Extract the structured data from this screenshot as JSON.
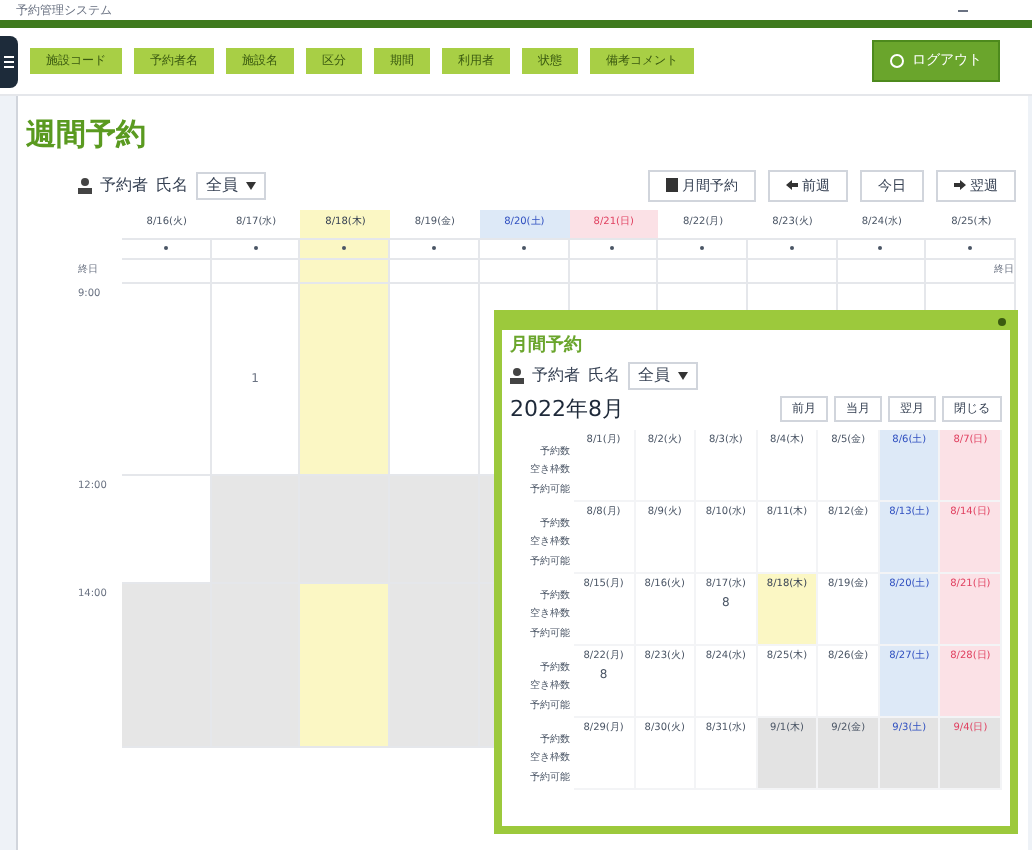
{
  "window": {
    "title": "予約管理システム"
  },
  "header": {
    "fields": [
      "施設コード",
      "予約者名",
      "施設名",
      "区分",
      "期間",
      "利用者",
      "状態",
      "備考コメント"
    ],
    "logout": "ログアウト"
  },
  "page_title": "週間予約",
  "filter": {
    "label": "予約者",
    "value": "氏名",
    "select": "全員"
  },
  "toolbar": [
    "月間予約",
    "前週",
    "今日",
    "翌週"
  ],
  "week": {
    "days": [
      {
        "label": "8/16(火)",
        "kind": "weekday"
      },
      {
        "label": "8/17(水)",
        "kind": "weekday"
      },
      {
        "label": "8/18(木)",
        "kind": "today"
      },
      {
        "label": "8/19(金)",
        "kind": "weekday"
      },
      {
        "label": "8/20(土)",
        "kind": "saturday"
      },
      {
        "label": "8/21(日)",
        "kind": "sunday"
      },
      {
        "label": "8/22(月)",
        "kind": "weekday"
      },
      {
        "label": "8/23(火)",
        "kind": "weekday"
      },
      {
        "label": "8/24(水)",
        "kind": "weekday"
      },
      {
        "label": "8/25(木)",
        "kind": "weekday"
      }
    ],
    "allday_left": "終日",
    "allday_right": "終日",
    "slots": [
      {
        "time": "9:00",
        "cells": [
          {
            "closed": false
          },
          {
            "text": "1",
            "closed": false
          },
          {
            "closed": false
          },
          {
            "closed": false
          },
          {
            "closed": false
          },
          {
            "closed": false
          },
          {
            "closed": false
          },
          {
            "closed": false
          },
          {
            "closed": false
          },
          {
            "closed": false
          }
        ]
      },
      {
        "time": "12:00",
        "cells": [
          {
            "closed": false
          },
          {
            "closed": true
          },
          {
            "closed": true
          },
          {
            "closed": true
          },
          {
            "closed": true
          }
        ]
      },
      {
        "time": "14:00",
        "cells": [
          {
            "closed": true
          },
          {
            "closed": true
          },
          {
            "closed": false
          },
          {
            "closed": true
          },
          {
            "closed": true
          }
        ]
      }
    ]
  },
  "month": {
    "title": "月間予約",
    "filter": {
      "label": "予約者",
      "value": "氏名",
      "select": "全員"
    },
    "heading": "2022年8月",
    "buttons": [
      "前月",
      "当月",
      "翌月",
      "閉じる"
    ],
    "weeks": [
      {
        "labels": [
          "予約数",
          "空き枠数",
          "予約可能"
        ],
        "days": [
          {
            "label": "8/1(月)",
            "kind": "weekday",
            "closed": false
          },
          {
            "label": "8/2(火)",
            "kind": "weekday",
            "closed": false
          },
          {
            "label": "8/3(水)",
            "kind": "weekday",
            "closed": false
          },
          {
            "label": "8/4(木)",
            "kind": "weekday",
            "closed": false
          },
          {
            "label": "8/5(金)",
            "kind": "weekday",
            "closed": false
          },
          {
            "label": "8/6(土)",
            "kind": "saturday",
            "closed": false
          },
          {
            "label": "8/7(日)",
            "kind": "sunday",
            "closed": false
          }
        ]
      },
      {
        "labels": [
          "予約数",
          "空き枠数",
          "予約可能"
        ],
        "days": [
          {
            "label": "8/8(月)",
            "kind": "weekday",
            "closed": false
          },
          {
            "label": "8/9(火)",
            "kind": "weekday",
            "closed": false
          },
          {
            "label": "8/10(水)",
            "kind": "weekday",
            "closed": false
          },
          {
            "label": "8/11(木)",
            "kind": "weekday",
            "closed": false
          },
          {
            "label": "8/12(金)",
            "kind": "weekday",
            "closed": false
          },
          {
            "label": "8/13(土)",
            "kind": "saturday",
            "closed": false
          },
          {
            "label": "8/14(日)",
            "kind": "sunday",
            "closed": false
          }
        ]
      },
      {
        "labels": [
          "予約数",
          "空き枠数",
          "予約可能"
        ],
        "days": [
          {
            "label": "8/15(月)",
            "kind": "weekday",
            "closed": false
          },
          {
            "label": "8/16(火)",
            "kind": "weekday",
            "closed": false
          },
          {
            "label": "8/17(水)",
            "kind": "weekday",
            "closed": false,
            "text": "8"
          },
          {
            "label": "8/18(木)",
            "kind": "today",
            "closed": false
          },
          {
            "label": "8/19(金)",
            "kind": "weekday",
            "closed": false
          },
          {
            "label": "8/20(土)",
            "kind": "saturday",
            "closed": false
          },
          {
            "label": "8/21(日)",
            "kind": "sunday",
            "closed": false
          }
        ]
      },
      {
        "labels": [
          "予約数",
          "空き枠数",
          "予約可能"
        ],
        "days": [
          {
            "label": "8/22(月)",
            "kind": "weekday",
            "closed": false,
            "text": "8"
          },
          {
            "label": "8/23(火)",
            "kind": "weekday",
            "closed": false
          },
          {
            "label": "8/24(水)",
            "kind": "weekday",
            "closed": false
          },
          {
            "label": "8/25(木)",
            "kind": "weekday",
            "closed": false
          },
          {
            "label": "8/26(金)",
            "kind": "weekday",
            "closed": false
          },
          {
            "label": "8/27(土)",
            "kind": "saturday",
            "closed": false
          },
          {
            "label": "8/28(日)",
            "kind": "sunday",
            "closed": false
          }
        ]
      },
      {
        "labels": [
          "予約数",
          "空き枠数",
          "予約可能"
        ],
        "days": [
          {
            "label": "8/29(月)",
            "kind": "weekday",
            "closed": false
          },
          {
            "label": "8/30(火)",
            "kind": "weekday",
            "closed": false
          },
          {
            "label": "8/31(水)",
            "kind": "weekday",
            "closed": false
          },
          {
            "label": "9/1(木)",
            "kind": "weekday",
            "closed": true
          },
          {
            "label": "9/2(金)",
            "kind": "weekday",
            "closed": true
          },
          {
            "label": "9/3(土)",
            "kind": "saturday",
            "closed": true
          },
          {
            "label": "9/4(日)",
            "kind": "sunday",
            "closed": true
          }
        ]
      }
    ]
  }
}
